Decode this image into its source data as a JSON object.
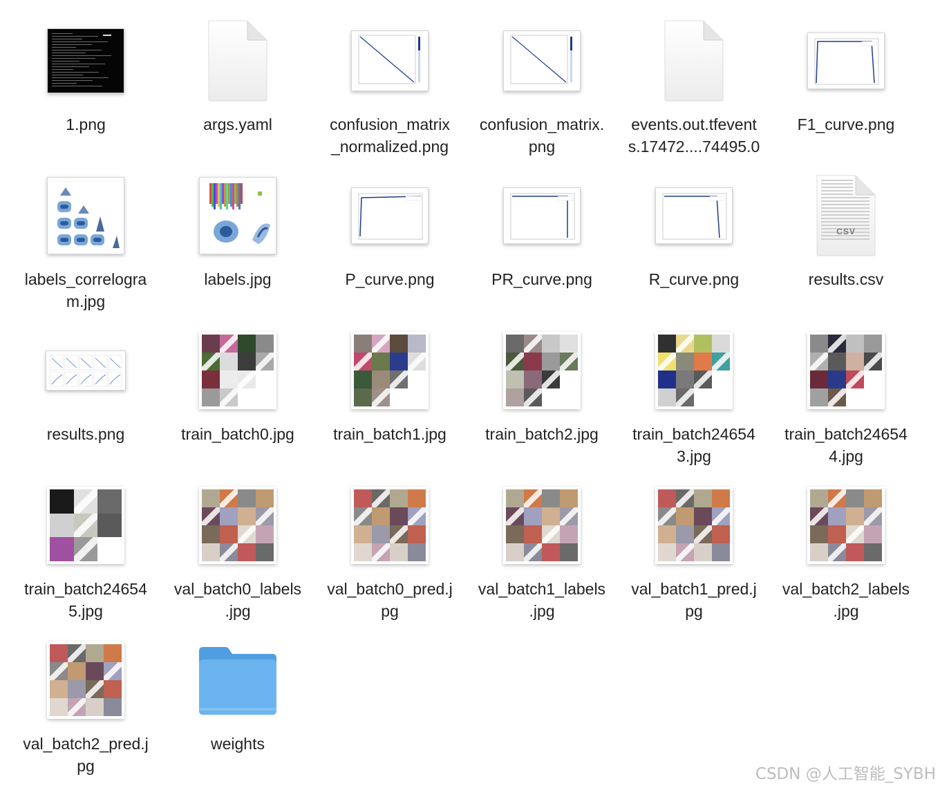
{
  "files": [
    {
      "name": "1.png",
      "icon": "terminal-thumbnail"
    },
    {
      "name": "args.yaml",
      "icon": "document-icon"
    },
    {
      "name": "confusion_matrix_normalized.png",
      "icon": "chart-thumbnail"
    },
    {
      "name": "confusion_matrix.png",
      "icon": "chart-thumbnail"
    },
    {
      "name": "events.out.tfevents.17472....74495.0",
      "icon": "document-icon"
    },
    {
      "name": "F1_curve.png",
      "icon": "chart-thumbnail"
    },
    {
      "name": "labels_correlogram.jpg",
      "icon": "chart-thumbnail"
    },
    {
      "name": "labels.jpg",
      "icon": "chart-thumbnail"
    },
    {
      "name": "P_curve.png",
      "icon": "chart-thumbnail"
    },
    {
      "name": "PR_curve.png",
      "icon": "chart-thumbnail"
    },
    {
      "name": "R_curve.png",
      "icon": "chart-thumbnail"
    },
    {
      "name": "results.csv",
      "icon": "csv-document-icon",
      "badge": "CSV"
    },
    {
      "name": "results.png",
      "icon": "chart-thumbnail"
    },
    {
      "name": "train_batch0.jpg",
      "icon": "image-thumbnail"
    },
    {
      "name": "train_batch1.jpg",
      "icon": "image-thumbnail"
    },
    {
      "name": "train_batch2.jpg",
      "icon": "image-thumbnail"
    },
    {
      "name": "train_batch246543.jpg",
      "icon": "image-thumbnail"
    },
    {
      "name": "train_batch246544.jpg",
      "icon": "image-thumbnail"
    },
    {
      "name": "train_batch246545.jpg",
      "icon": "image-thumbnail"
    },
    {
      "name": "val_batch0_labels.jpg",
      "icon": "image-thumbnail"
    },
    {
      "name": "val_batch0_pred.jpg",
      "icon": "image-thumbnail"
    },
    {
      "name": "val_batch1_labels.jpg",
      "icon": "image-thumbnail"
    },
    {
      "name": "val_batch1_pred.jpg",
      "icon": "image-thumbnail"
    },
    {
      "name": "val_batch2_labels.jpg",
      "icon": "image-thumbnail"
    },
    {
      "name": "val_batch2_pred.jpg",
      "icon": "image-thumbnail"
    },
    {
      "name": "weights",
      "icon": "folder-icon"
    }
  ],
  "display_names": [
    "1.png",
    "args.yaml",
    [
      "confusion_matrix",
      "_normalized.png"
    ],
    [
      "confusion_matrix.",
      "png"
    ],
    [
      "events.out.tfevent",
      "s.17472....74495.0"
    ],
    "F1_curve.png",
    [
      "labels_correlogra",
      "m.jpg"
    ],
    "labels.jpg",
    "P_curve.png",
    "PR_curve.png",
    "R_curve.png",
    "results.csv",
    "results.png",
    "train_batch0.jpg",
    "train_batch1.jpg",
    "train_batch2.jpg",
    [
      "train_batch24654",
      "3.jpg"
    ],
    [
      "train_batch24654",
      "4.jpg"
    ],
    [
      "train_batch24654",
      "5.jpg"
    ],
    [
      "val_batch0_labels",
      ".jpg"
    ],
    [
      "val_batch0_pred.j",
      "pg"
    ],
    [
      "val_batch1_labels",
      ".jpg"
    ],
    [
      "val_batch1_pred.j",
      "pg"
    ],
    [
      "val_batch2_labels",
      ".jpg"
    ],
    [
      "val_batch2_pred.j",
      "pg"
    ],
    "weights"
  ],
  "watermark": "CSDN @人工智能_SYBH",
  "colors": {
    "folder": "#6cb4ef",
    "folder_tab": "#4f9fe0",
    "chart_line": "#1f3b8a"
  }
}
